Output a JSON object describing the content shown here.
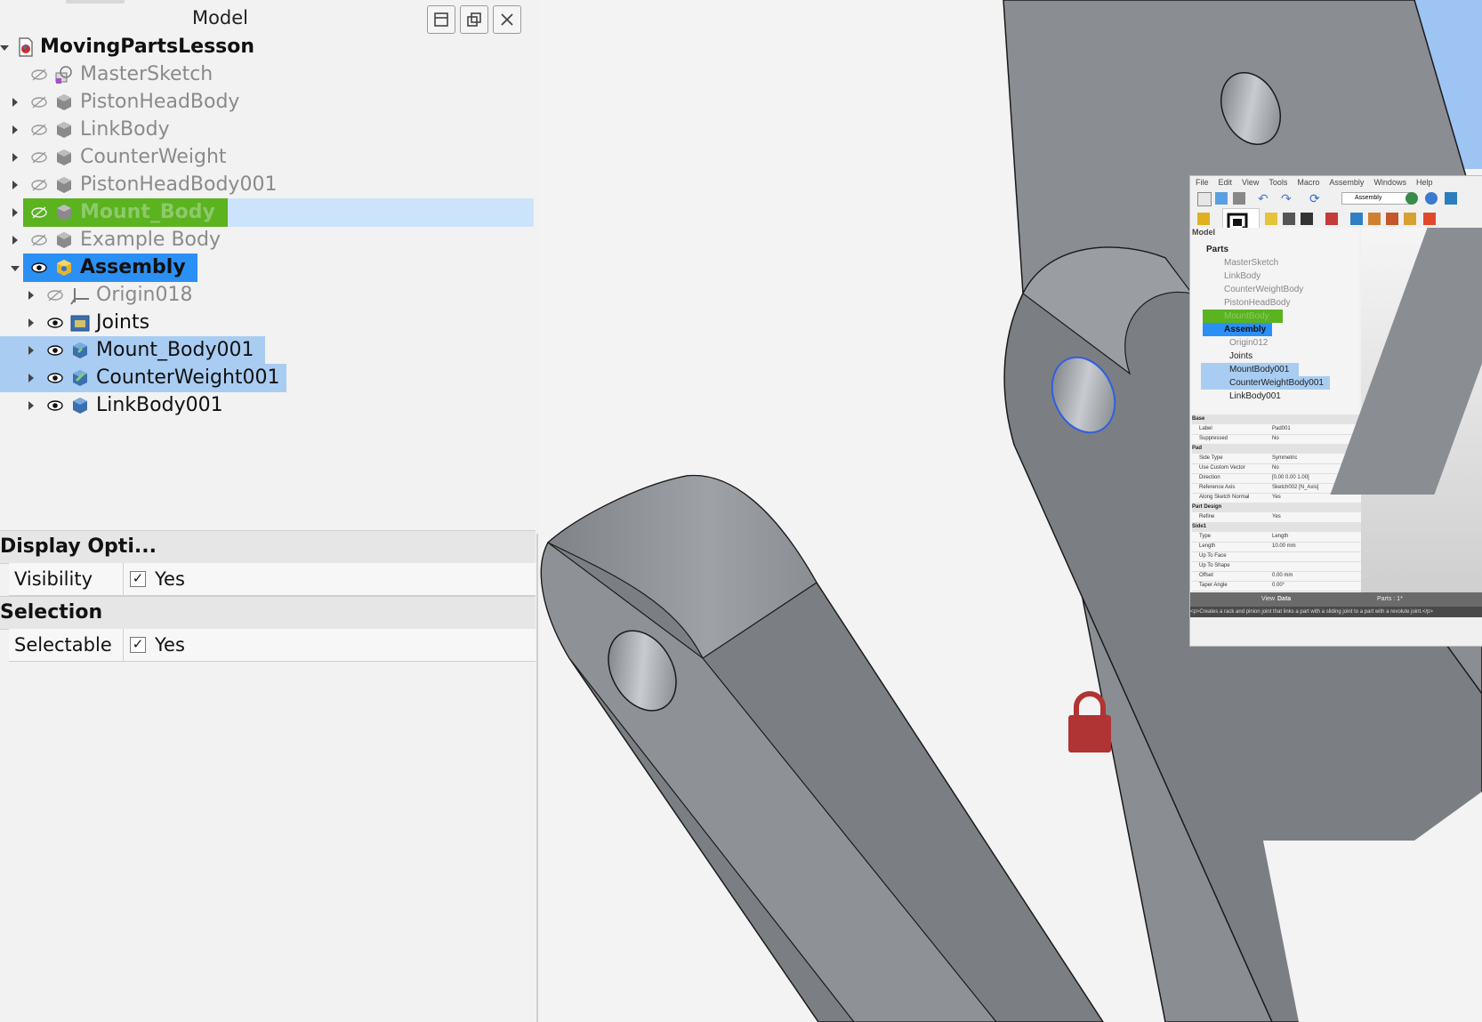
{
  "panel": {
    "title": "Model",
    "buttons": [
      "dock",
      "float",
      "close"
    ]
  },
  "tree": {
    "root": "MovingPartsLesson",
    "items": [
      {
        "label": "MasterSketch",
        "visible": false
      },
      {
        "label": "PistonHeadBody",
        "visible": false
      },
      {
        "label": "LinkBody",
        "visible": false
      },
      {
        "label": "CounterWeight",
        "visible": false
      },
      {
        "label": "PistonHeadBody001",
        "visible": false
      },
      {
        "label": "Mount_Body",
        "visible": false,
        "highlight": "#5ab31f"
      },
      {
        "label": "Example Body",
        "visible": false
      },
      {
        "label": "Assembly",
        "visible": true,
        "highlight": "#2b90f5"
      }
    ],
    "children": [
      {
        "label": "Origin018",
        "visible": false
      },
      {
        "label": "Joints",
        "visible": true
      },
      {
        "label": "Mount_Body001",
        "visible": true,
        "selected": true
      },
      {
        "label": "CounterWeight001",
        "visible": true,
        "selected": true
      },
      {
        "label": "LinkBody001",
        "visible": true
      }
    ]
  },
  "properties": {
    "sections": [
      {
        "title": "Display Opti...",
        "rows": [
          {
            "key": "Visibility",
            "value": "Yes"
          }
        ]
      },
      {
        "title": "Selection",
        "rows": [
          {
            "key": "Selectable",
            "value": "Yes"
          }
        ]
      }
    ]
  },
  "inset": {
    "menu": [
      "File",
      "Edit",
      "View",
      "Tools",
      "Macro",
      "Assembly",
      "Windows",
      "Help"
    ],
    "workbench": "Assembly",
    "model_tab": "Model",
    "tree_root": "Parts",
    "tree": [
      "MasterSketch",
      "LinkBody",
      "CounterWeightBody",
      "PistonHeadBody",
      "MountBody",
      "Assembly"
    ],
    "tree_children": [
      "Origin012",
      "Joints",
      "MountBody001",
      "CounterWeightBody001",
      "LinkBody001"
    ],
    "props": [
      {
        "section": "Base"
      },
      {
        "key": "Label",
        "value": "Pad001"
      },
      {
        "key": "Suppressed",
        "value": "No"
      },
      {
        "section": "Pad"
      },
      {
        "key": "Side Type",
        "value": "Symmetric"
      },
      {
        "key": "Use Custom Vector",
        "value": "No"
      },
      {
        "key": "Direction",
        "value": "[0.00 0.00 1.00]"
      },
      {
        "key": "Reference Axis",
        "value": "Sketch002 [N_Axis]"
      },
      {
        "key": "Along Sketch Normal",
        "value": "Yes"
      },
      {
        "section": "Part Design"
      },
      {
        "key": "Refine",
        "value": "Yes"
      },
      {
        "section": "Side1"
      },
      {
        "key": "Type",
        "value": "Length"
      },
      {
        "key": "Length",
        "value": "10.00 mm"
      },
      {
        "key": "Up To Face",
        "value": ""
      },
      {
        "key": "Up To Shape",
        "value": ""
      },
      {
        "key": "Offset",
        "value": "0.00 mm"
      },
      {
        "key": "Taper Angle",
        "value": "0.00°"
      }
    ],
    "view_tab": "View",
    "data_tab": "Data",
    "parts_label": "Parts : 1*",
    "status": "<p>Creates a rack and pinion joint that links a part with a sliding joint to a part with a revolute joint.</p>"
  },
  "colors": {
    "green_highlight": "#5ab31f",
    "blue_highlight": "#2b90f5",
    "selection": "#a9cdf2",
    "part_gray": "#8a8d92",
    "lock_red": "#b03434"
  }
}
